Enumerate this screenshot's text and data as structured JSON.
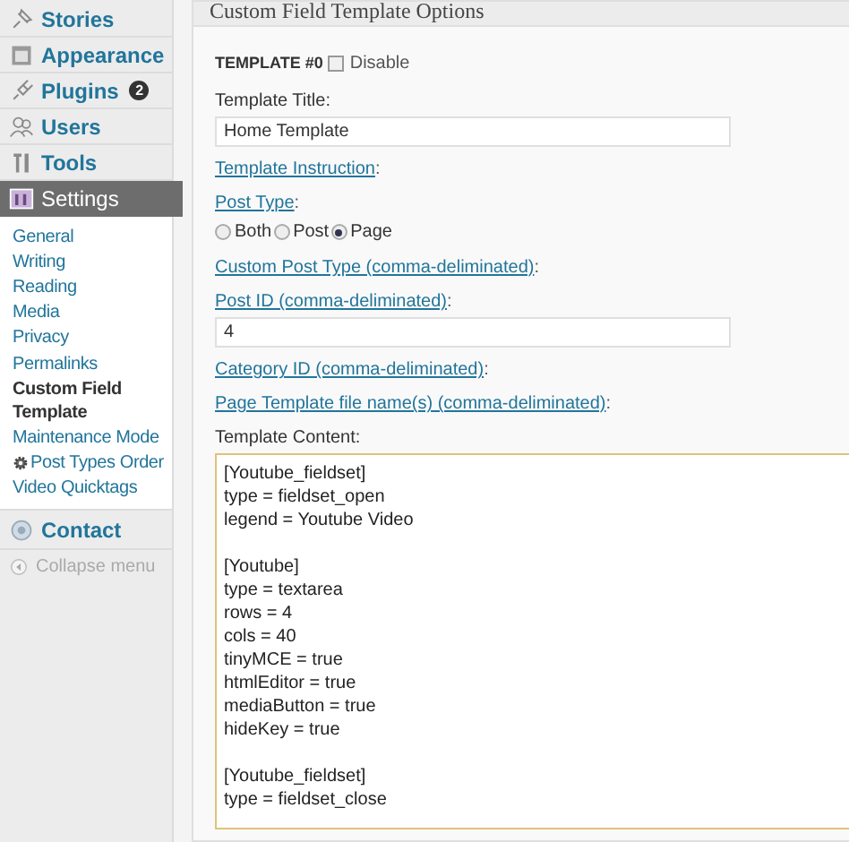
{
  "sidebar": {
    "items": [
      {
        "label": "Stories",
        "kind": "main",
        "selected": false
      },
      {
        "label": "Appearance",
        "kind": "main",
        "selected": false
      },
      {
        "label": "Plugins",
        "kind": "main",
        "selected": false,
        "badge": "2"
      },
      {
        "label": "Users",
        "kind": "main",
        "selected": false
      },
      {
        "label": "Tools",
        "kind": "main",
        "selected": false
      },
      {
        "label": "Settings",
        "kind": "main",
        "selected": true,
        "children": [
          {
            "label": "General",
            "selected": false
          },
          {
            "label": "Writing",
            "selected": false
          },
          {
            "label": "Reading",
            "selected": false
          },
          {
            "label": "Media",
            "selected": false
          },
          {
            "label": "Privacy",
            "selected": false
          },
          {
            "label": "Permalinks",
            "selected": false
          },
          {
            "label": "Custom Field Template",
            "selected": true
          },
          {
            "label": "Maintenance Mode",
            "selected": false
          },
          {
            "label": "Post Types Order",
            "selected": false,
            "kind": "gear"
          },
          {
            "label": "Video Quicktags",
            "selected": false
          }
        ]
      },
      {
        "label": "Contact",
        "kind": "main",
        "selected": false
      },
      {
        "label": "Collapse menu",
        "kind": "collapse"
      }
    ]
  },
  "panel": {
    "title": "Custom Field Template Options",
    "template_heading": "TEMPLATE #0",
    "disable": {
      "label": "Disable",
      "checked": false
    },
    "fields": [
      {
        "kind": "text",
        "label": "Template Title:",
        "value": "Home Template"
      },
      {
        "kind": "link",
        "label": "Template Instruction",
        "suffix": ":"
      },
      {
        "kind": "radio",
        "label": "Post Type",
        "suffix": ":",
        "options": [
          {
            "label": "Both",
            "selected": false
          },
          {
            "label": "Post",
            "selected": false
          },
          {
            "label": "Page",
            "selected": true
          }
        ]
      },
      {
        "kind": "link",
        "label": "Custom Post Type (comma-deliminated)",
        "suffix": ":"
      },
      {
        "kind": "linktext",
        "label": "Post ID (comma-deliminated)",
        "suffix": ":",
        "value": "4"
      },
      {
        "kind": "link",
        "label": "Category ID (comma-deliminated)",
        "suffix": ":"
      },
      {
        "kind": "link",
        "label": "Page Template file name(s) (comma-deliminated)",
        "suffix": ":"
      },
      {
        "kind": "textarea",
        "label": "Template Content:",
        "value": "[Youtube_fieldset]\ntype = fieldset_open\nlegend = Youtube Video\n\n[Youtube]\ntype = textarea\nrows = 4\ncols = 40\ntinyMCE = true\nhtmlEditor = true\nmediaButton = true\nhideKey = true\n\n[Youtube_fieldset]\ntype = fieldset_close"
      }
    ]
  }
}
